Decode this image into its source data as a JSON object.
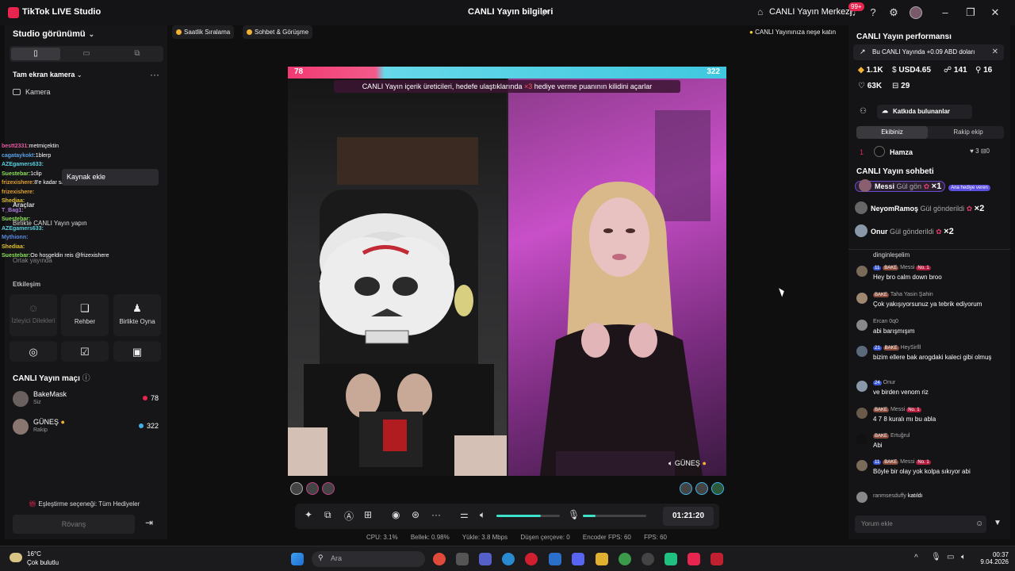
{
  "titlebar": {
    "app_name": "TikTok LIVE Studio",
    "live_info": "CANLI Yayın bilgileri",
    "live_center": "CANLI Yayın Merkezi",
    "notif_badge": "99+"
  },
  "left": {
    "studio_view": "Studio görünümü",
    "fullscreen_camera": "Tam ekran kamera",
    "camera": "Kamera",
    "add_source_tooltip": "Kaynak ekle",
    "tools_heading": "Araçlar",
    "invite_live": "Birlikte CANLI Yayın yapın",
    "shared_stream": "Ortak yayında",
    "interaction_heading": "Etkileşim",
    "tiles": [
      "İzleyici Dilekleri",
      "Rehber",
      "Birlikte Oyna"
    ],
    "chat_overlay": [
      {
        "user": "bestt2331:",
        "text": "metmiçektin",
        "color": "#e55aa0"
      },
      {
        "user": "cagataykokt:",
        "text": "1blerp",
        "color": "#5aa0e5"
      },
      {
        "user": "AZEgamers633:",
        "text": "",
        "color": "#5ad0e0"
      },
      {
        "user": "Suestebar:",
        "text": "1clip",
        "color": "#8ae05a"
      },
      {
        "user": "frizexishere:",
        "text": "8'e kadar saysın",
        "color": "#e0a030"
      },
      {
        "user": "frizexishere:",
        "text": "",
        "color": "#e0a030"
      },
      {
        "user": "Shediaa:",
        "text": "",
        "color": "#e0c030"
      },
      {
        "user": "T_Bag1:",
        "text": "",
        "color": "#b07ae0"
      },
      {
        "user": "Suestebar:",
        "text": "",
        "color": "#8ae05a"
      },
      {
        "user": "AZEgamers633:",
        "text": "",
        "color": "#5ad0e0"
      },
      {
        "user": "Mythionn:",
        "text": "",
        "color": "#5a8ae0"
      },
      {
        "user": "Shediaa:",
        "text": "",
        "color": "#e0c030"
      },
      {
        "user": "Suestebar:",
        "text": "Oo hoşgeldin reis @frizexishere",
        "color": "#8ae05a"
      }
    ]
  },
  "match": {
    "title": "CANLI Yayın maçı",
    "players": [
      {
        "name": "BakeMask",
        "sub": "Siz",
        "score": "78",
        "dot": "#e8254f"
      },
      {
        "name": "GÜNEŞ",
        "sub": "Rakip",
        "score": "322",
        "dot": "#3fb0e8"
      }
    ],
    "option": "Eşleştirme seçeneği: Tüm Hediyeler",
    "rematch": "Rövanş"
  },
  "chips": {
    "hourly": "Saatlik Sıralama",
    "chat": "Sohbet & Görüşme",
    "tip": "CANLI Yayınınıza neşe katın"
  },
  "video": {
    "score_left": "78",
    "score_right": "322",
    "banner_pre": "CANLI Yayın içerik üreticileri, hedefe ulaştıklarında ",
    "banner_x3": "×3",
    "banner_post": " hediye verme puanının kilidini açarlar",
    "opponent_tag": "GÜNEŞ"
  },
  "controls": {
    "timer": "01:21:20",
    "volume": 0.7,
    "mic": 0.2
  },
  "stats": {
    "cpu": "CPU: 3.1%",
    "memory": "Bellek: 0.98%",
    "upload": "Yükle: 3.8 Mbps",
    "dropped": "Düşen çerçeve: 0",
    "encoder_fps": "Encoder FPS: 60",
    "fps": "FPS: 60"
  },
  "right": {
    "perf_title": "CANLI Yayın performansı",
    "earnings": "Bu CANLI Yayında +0.09 ABD doları",
    "stats": [
      "1.1K",
      "USD4.65",
      "141",
      "16",
      "63K",
      "29"
    ],
    "contributors": "Katkıda bulunanlar",
    "tab_team": "Ekibiniz",
    "tab_rival": "Rakip ekip",
    "rank": {
      "pos": "1",
      "name": "Hamza",
      "likes": "3",
      "gifts": "0"
    },
    "chat_title": "CANLI Yayın sohbeti",
    "gifts": [
      {
        "user": "Messi",
        "action": "Gül gön",
        "count": "×1",
        "tag": "Ana hediye veren"
      },
      {
        "user": "NeyomRamoş",
        "action": "Gül gönderildi",
        "count": "×2",
        "tag": ""
      },
      {
        "user": "Onur",
        "action": "Gül gönderildi",
        "count": "×2",
        "tag": ""
      }
    ],
    "cut_text": "dinginleşelim",
    "messages": [
      {
        "lvl": "11",
        "fan": "BAKE",
        "user": "Messi",
        "no1": "No. 1",
        "text": "Hey bro calm down broo"
      },
      {
        "lvl": "",
        "fan": "BAKE",
        "user": "Taha Yasin Şahin",
        "no1": "",
        "text": "Çok yakışıyorsunuz ya tebrik ediyorum"
      },
      {
        "lvl": "",
        "fan": "",
        "user": "Ercan 0q0",
        "no1": "",
        "text": "abi barışmışım"
      },
      {
        "lvl": "21",
        "fan": "BAKE",
        "user": "HeySirlll",
        "no1": "",
        "text": "bizim ellere bak arogdaki kaleci gibi olmuş"
      },
      {
        "lvl": "24",
        "fan": "",
        "user": "Onur",
        "no1": "",
        "text": "ve birden venom riz"
      },
      {
        "lvl": "",
        "fan": "BAKE",
        "user": "Messi",
        "no1": "No. 1",
        "text": "4 7 8 kuralı mı bu abla"
      },
      {
        "lvl": "",
        "fan": "BAKE",
        "user": "Ertuğrul",
        "no1": "",
        "text": "Abi"
      },
      {
        "lvl": "11",
        "fan": "BAKE",
        "user": "Messi",
        "no1": "No. 1",
        "text": "Böyle bir olay yok kolpa sıkıyor abi"
      }
    ],
    "joined_user": "ranmsesduffy",
    "joined_text": "katıldı",
    "comment_placeholder": "Yorum ekle"
  },
  "taskbar": {
    "temp": "16°C",
    "weather": "Çok bulutlu",
    "search": "Ara",
    "time": "00:37",
    "date": "9.04.2026"
  }
}
